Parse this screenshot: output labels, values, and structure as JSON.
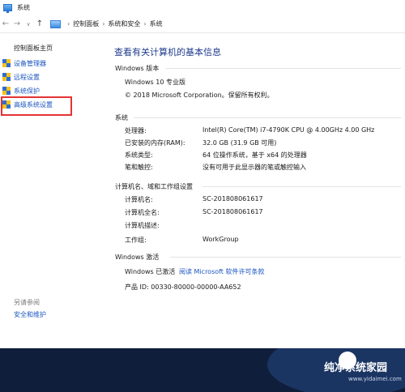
{
  "window": {
    "title": "系统"
  },
  "address": {
    "crumbs": [
      "控制面板",
      "系统和安全",
      "系统"
    ]
  },
  "left": {
    "home": "控制面板主页",
    "items": [
      "设备管理器",
      "远程设置",
      "系统保护",
      "高级系统设置"
    ],
    "see_also": "另请参阅",
    "see_also_link": "安全和维护"
  },
  "main": {
    "title": "查看有关计算机的基本信息",
    "edition": {
      "header": "Windows 版本",
      "name": "Windows 10 专业版",
      "copyright": "© 2018 Microsoft Corporation。保留所有权利。"
    },
    "system": {
      "header": "系统",
      "rows": [
        {
          "label": "处理器:",
          "value": "Intel(R) Core(TM) i7-4790K CPU @ 4.00GHz   4.00 GHz"
        },
        {
          "label": "已安装的内存(RAM):",
          "value": "32.0 GB (31.9 GB 可用)"
        },
        {
          "label": "系统类型:",
          "value": "64 位操作系统，基于 x64 的处理器"
        },
        {
          "label": "笔和触控:",
          "value": "没有可用于此显示器的笔或触控输入"
        }
      ]
    },
    "computer": {
      "header": "计算机名、域和工作组设置",
      "rows": [
        {
          "label": "计算机名:",
          "value": "SC-201808061617"
        },
        {
          "label": "计算机全名:",
          "value": "SC-201808061617"
        },
        {
          "label": "计算机描述:",
          "value": ""
        },
        {
          "label": "工作组:",
          "value": "WorkGroup"
        }
      ]
    },
    "activation": {
      "header": "Windows 激活",
      "status": "Windows 已激活",
      "license_link": "阅读 Microsoft 软件许可条款",
      "product_id": "产品 ID: 00330-80000-00000-AA652"
    }
  },
  "watermark": {
    "title": "纯净系统家园",
    "url": "www.yidaimei.com"
  }
}
